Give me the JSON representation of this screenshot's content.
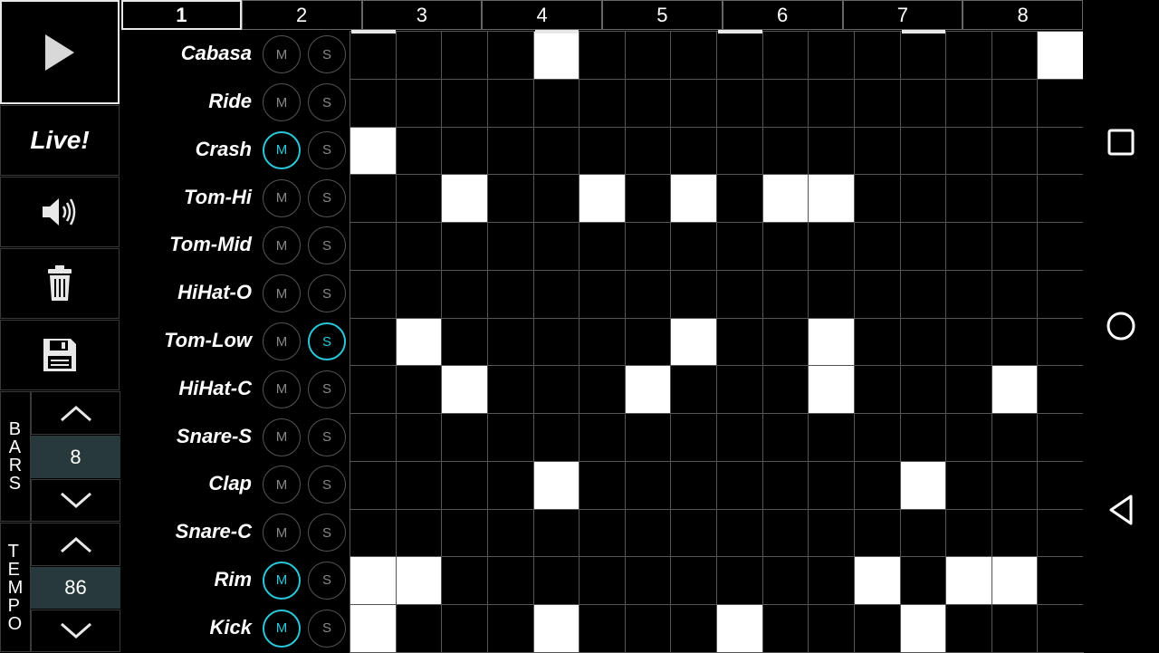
{
  "bars_tabs": [
    "1",
    "2",
    "3",
    "4",
    "5",
    "6",
    "7",
    "8"
  ],
  "active_bar": 0,
  "sidebar": {
    "live_label": "Live!",
    "bars_label": "BARS",
    "bars_value": "8",
    "tempo_label": "TEMPO",
    "tempo_value": "86"
  },
  "mute_label": "M",
  "solo_label": "S",
  "accent_color": "#29c7d8",
  "tracks": [
    {
      "name": "Cabasa",
      "mute": false,
      "solo": false,
      "steps": [
        0,
        0,
        0,
        0,
        1,
        0,
        0,
        0,
        0,
        0,
        0,
        0,
        0,
        0,
        0,
        1
      ]
    },
    {
      "name": "Ride",
      "mute": false,
      "solo": false,
      "steps": [
        0,
        0,
        0,
        0,
        0,
        0,
        0,
        0,
        0,
        0,
        0,
        0,
        0,
        0,
        0,
        0
      ]
    },
    {
      "name": "Crash",
      "mute": true,
      "solo": false,
      "steps": [
        1,
        0,
        0,
        0,
        0,
        0,
        0,
        0,
        0,
        0,
        0,
        0,
        0,
        0,
        0,
        0
      ]
    },
    {
      "name": "Tom-Hi",
      "mute": false,
      "solo": false,
      "steps": [
        0,
        0,
        1,
        0,
        0,
        1,
        0,
        1,
        0,
        1,
        1,
        0,
        0,
        0,
        0,
        0
      ]
    },
    {
      "name": "Tom-Mid",
      "mute": false,
      "solo": false,
      "steps": [
        0,
        0,
        0,
        0,
        0,
        0,
        0,
        0,
        0,
        0,
        0,
        0,
        0,
        0,
        0,
        0
      ]
    },
    {
      "name": "HiHat-O",
      "mute": false,
      "solo": false,
      "steps": [
        0,
        0,
        0,
        0,
        0,
        0,
        0,
        0,
        0,
        0,
        0,
        0,
        0,
        0,
        0,
        0
      ]
    },
    {
      "name": "Tom-Low",
      "mute": false,
      "solo": true,
      "steps": [
        0,
        1,
        0,
        0,
        0,
        0,
        0,
        1,
        0,
        0,
        1,
        0,
        0,
        0,
        0,
        0
      ]
    },
    {
      "name": "HiHat-C",
      "mute": false,
      "solo": false,
      "steps": [
        0,
        0,
        1,
        0,
        0,
        0,
        1,
        0,
        0,
        0,
        1,
        0,
        0,
        0,
        1,
        0
      ]
    },
    {
      "name": "Snare-S",
      "mute": false,
      "solo": false,
      "steps": [
        0,
        0,
        0,
        0,
        0,
        0,
        0,
        0,
        0,
        0,
        0,
        0,
        0,
        0,
        0,
        0
      ]
    },
    {
      "name": "Clap",
      "mute": false,
      "solo": false,
      "steps": [
        0,
        0,
        0,
        0,
        1,
        0,
        0,
        0,
        0,
        0,
        0,
        0,
        1,
        0,
        0,
        0
      ]
    },
    {
      "name": "Snare-C",
      "mute": false,
      "solo": false,
      "steps": [
        0,
        0,
        0,
        0,
        0,
        0,
        0,
        0,
        0,
        0,
        0,
        0,
        0,
        0,
        0,
        0
      ]
    },
    {
      "name": "Rim",
      "mute": true,
      "solo": false,
      "steps": [
        1,
        1,
        0,
        0,
        0,
        0,
        0,
        0,
        0,
        0,
        0,
        1,
        0,
        1,
        1,
        0
      ]
    },
    {
      "name": "Kick",
      "mute": true,
      "solo": false,
      "steps": [
        1,
        0,
        0,
        0,
        1,
        0,
        0,
        0,
        1,
        0,
        0,
        0,
        1,
        0,
        0,
        0
      ]
    }
  ]
}
